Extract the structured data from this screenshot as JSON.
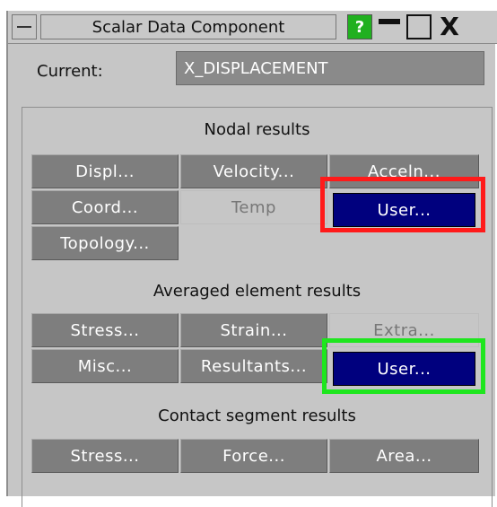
{
  "window": {
    "title": "Scalar Data Component",
    "help_label": "?",
    "close_label": "X"
  },
  "current": {
    "label": "Current:",
    "value": "X_DISPLACEMENT"
  },
  "nodal": {
    "heading": "Nodal results",
    "displ": "Displ...",
    "velocity": "Velocity...",
    "acceln": "Acceln...",
    "coord": "Coord...",
    "temp": "Temp",
    "user": "User...",
    "topology": "Topology..."
  },
  "averaged": {
    "heading": "Averaged element results",
    "stress": "Stress...",
    "strain": "Strain...",
    "extra": "Extra...",
    "misc": "Misc...",
    "resultants": "Resultants...",
    "user": "User..."
  },
  "contact": {
    "heading": "Contact segment results",
    "stress": "Stress...",
    "force": "Force...",
    "area": "Area..."
  },
  "colors": {
    "button": "#7e7e7e",
    "selected": "#00007e",
    "highlight_red": "#ff1a1a",
    "highlight_green": "#1ee61e",
    "help": "#21b020"
  }
}
